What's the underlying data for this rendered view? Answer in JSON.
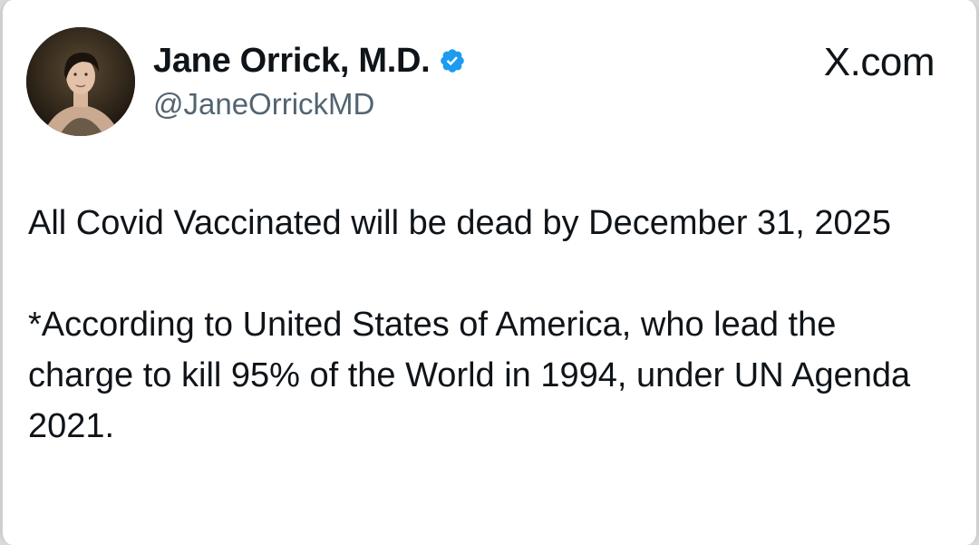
{
  "tweet": {
    "author": {
      "name": "Jane Orrick, M.D.",
      "handle": "@JaneOrrickMD",
      "verified": true,
      "verified_color": "#1d9bf0"
    },
    "brand_label": "X.com",
    "paragraphs": [
      "All Covid Vaccinated will be dead by December 31, 2025",
      "*According to United States of America, who lead the charge to kill 95% of the World in 1994, under UN Agenda 2021."
    ]
  },
  "colors": {
    "text": "#0f1419",
    "secondary_text": "#536471",
    "background": "#ffffff"
  }
}
